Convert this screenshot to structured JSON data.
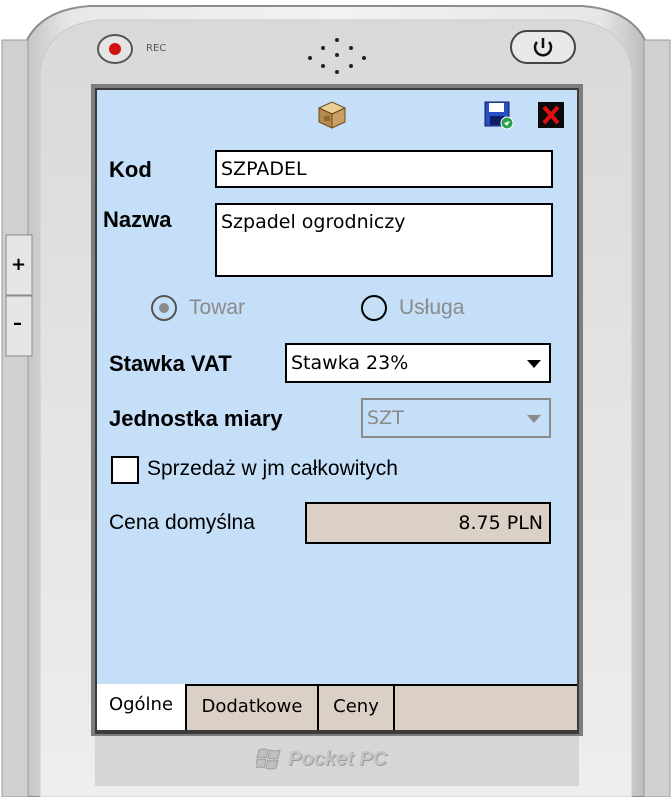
{
  "device": {
    "rec_label": "REC",
    "brand": "Pocket PC",
    "colors": {
      "screen": "#c4dff7",
      "tabbar": "#dbd0c6",
      "disabled": "#8a8a8a"
    }
  },
  "toolbar": {
    "product_icon": "package-icon",
    "save_icon": "save-icon",
    "close_icon": "close-icon"
  },
  "form": {
    "kod": {
      "label": "Kod",
      "value": "SZPADEL"
    },
    "nazwa": {
      "label": "Nazwa",
      "value": "Szpadel ogrodniczy"
    },
    "type": {
      "options": [
        {
          "label": "Towar",
          "selected": true,
          "enabled": false
        },
        {
          "label": "Usługa",
          "selected": false,
          "enabled": false
        }
      ]
    },
    "vat": {
      "label": "Stawka VAT",
      "value": "Stawka 23%"
    },
    "unit": {
      "label": "Jednostka miary",
      "value": "SZT",
      "enabled": false
    },
    "integer_sale": {
      "label": "Sprzedaż w jm całkowitych",
      "checked": false
    },
    "price": {
      "label": "Cena domyślna",
      "value": "8.75 PLN"
    }
  },
  "tabs": [
    {
      "label": "Ogólne",
      "active": true
    },
    {
      "label": "Dodatkowe",
      "active": false
    },
    {
      "label": "Ceny",
      "active": false
    }
  ]
}
